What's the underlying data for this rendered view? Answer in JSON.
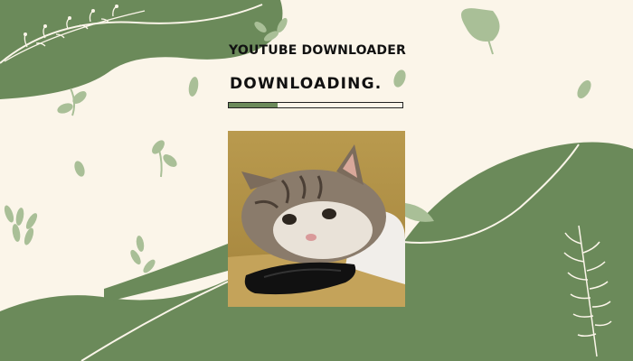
{
  "app": {
    "title": "YOUTUBE DOWNLOADER",
    "status_text": "DOWNLOADING."
  },
  "progress": {
    "fraction": 0.28
  },
  "colors": {
    "background": "#fbf5e9",
    "accent_green": "#6b8a5a",
    "light_green": "#a9bf97",
    "text": "#111111"
  },
  "preview": {
    "subject": "cat resting head on phone"
  }
}
